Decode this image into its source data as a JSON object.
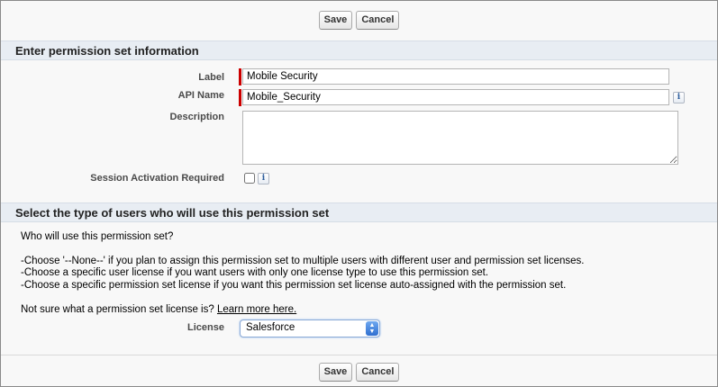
{
  "buttons": {
    "save": "Save",
    "cancel": "Cancel"
  },
  "section1": {
    "title": "Enter permission set information",
    "label_label": "Label",
    "label_value": "Mobile Security",
    "api_label": "API Name",
    "api_value": "Mobile_Security",
    "description_label": "Description",
    "description_value": "",
    "session_label": "Session Activation Required",
    "info_glyph": "i"
  },
  "section2": {
    "title": "Select the type of users who will use this permission set",
    "question": "Who will use this permission set?",
    "line1": "-Choose '--None--' if you plan to assign this permission set to multiple users with different user and permission set licenses.",
    "line2": "-Choose a specific user license if you want users with only one license type to use this permission set.",
    "line3": "-Choose a specific permission set license if you want this permission set license auto-assigned with the permission set.",
    "not_sure": "Not sure what a permission set license is? ",
    "learn_more": "Learn more here.",
    "license_label": "License",
    "license_value": "Salesforce",
    "caret_up": "▲",
    "caret_down": "▼"
  }
}
